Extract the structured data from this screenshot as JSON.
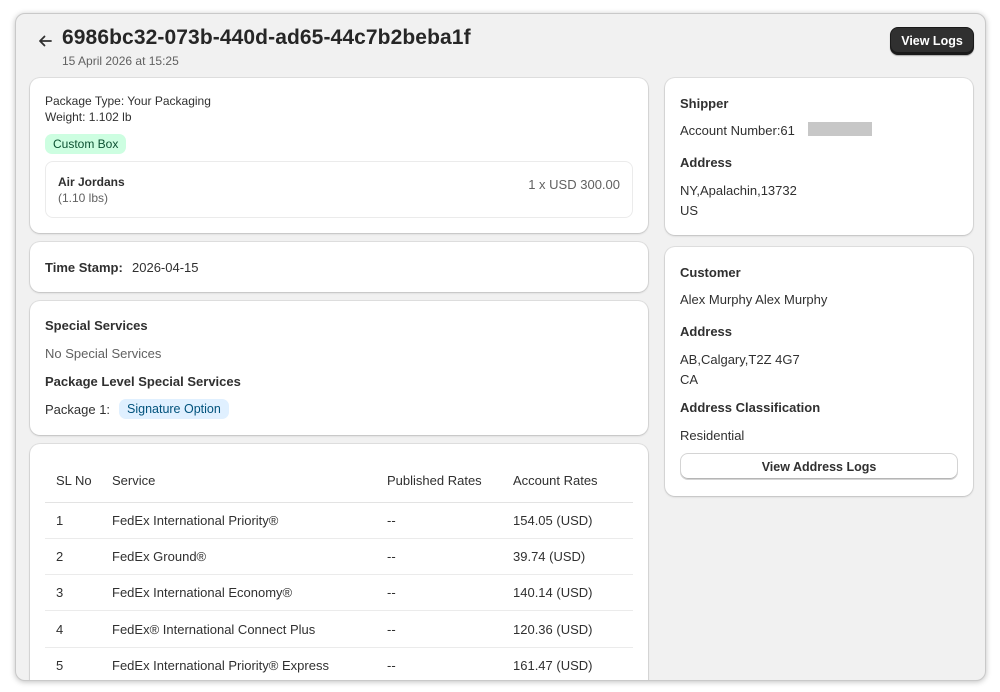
{
  "header": {
    "title": "6986bc32-073b-440d-ad65-44c7b2beba1f",
    "subtitle": "15 April 2026 at 15:25",
    "view_logs_label": "View Logs"
  },
  "package": {
    "type_line": "Package Type: Your Packaging",
    "weight_line": "Weight: 1.102 lb",
    "box_badge": "Custom Box",
    "item": {
      "name": "Air Jordans",
      "weight": "(1.10 lbs)",
      "price": "1 x USD 300.00"
    }
  },
  "timestamp": {
    "label": "Time Stamp:",
    "value": "2026-04-15"
  },
  "special_services": {
    "title": "Special Services",
    "value": "No Special Services",
    "package_level_title": "Package Level Special Services",
    "package_label": "Package 1:",
    "package_badge": "Signature Option"
  },
  "rates_table": {
    "headers": [
      "SL No",
      "Service",
      "Published Rates",
      "Account Rates"
    ],
    "rows": [
      {
        "sl": "1",
        "service": "FedEx International Priority®",
        "published": "--",
        "account": "154.05 (USD)"
      },
      {
        "sl": "2",
        "service": "FedEx Ground®",
        "published": "--",
        "account": "39.74 (USD)"
      },
      {
        "sl": "3",
        "service": "FedEx International Economy®",
        "published": "--",
        "account": "140.14 (USD)"
      },
      {
        "sl": "4",
        "service": "FedEx® International Connect Plus",
        "published": "--",
        "account": "120.36 (USD)"
      },
      {
        "sl": "5",
        "service": "FedEx International Priority® Express",
        "published": "--",
        "account": "161.47 (USD)"
      }
    ]
  },
  "shipper": {
    "title": "Shipper",
    "account_number": "Account Number:61",
    "address_title": "Address",
    "address_line1": "NY,Apalachin,13732",
    "address_line2": "US"
  },
  "customer": {
    "title": "Customer",
    "name": "Alex Murphy Alex Murphy",
    "address_title": "Address",
    "address_line1": "AB,Calgary,T2Z 4G7",
    "address_line2": "CA",
    "classification_title": "Address Classification",
    "classification_value": "Residential",
    "view_address_logs_label": "View Address Logs"
  },
  "colors": {
    "primary_button": "#303030",
    "badge_green_bg": "#cdfee1",
    "badge_blue_bg": "#e0f0ff",
    "page_bg": "#f1f1f1"
  },
  "icons": {
    "back": "arrow-left-icon"
  }
}
